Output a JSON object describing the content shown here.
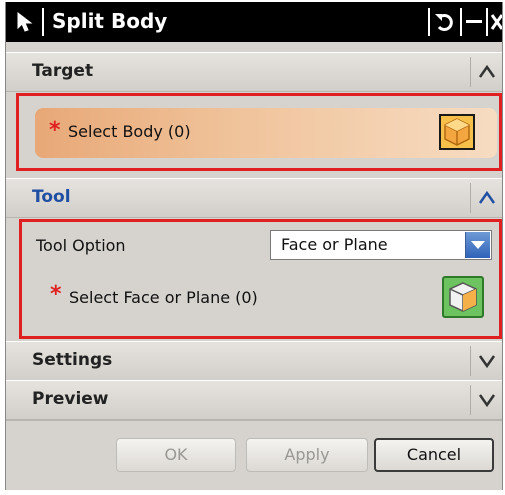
{
  "dialog": {
    "title": "Split Body"
  },
  "groups": {
    "target": {
      "label": "Target",
      "expanded": true
    },
    "tool": {
      "label": "Tool",
      "expanded": true
    },
    "settings": {
      "label": "Settings",
      "expanded": false
    },
    "preview": {
      "label": "Preview",
      "expanded": false
    }
  },
  "target": {
    "required_marker": "*",
    "select_body_label": "Select Body (0)",
    "button_icon": "solid-body-icon"
  },
  "tool": {
    "tool_option_label": "Tool Option",
    "tool_option_value": "Face or Plane",
    "required_marker": "*",
    "select_face_label": "Select Face or Plane (0)",
    "button_icon": "face-select-icon"
  },
  "footer": {
    "ok_label": "OK",
    "apply_label": "Apply",
    "cancel_label": "Cancel"
  },
  "colors": {
    "accent_blue": "#1f4fa3",
    "required_red": "#e02020",
    "highlight_red": "#e02020",
    "target_bar": "#f0c49c"
  }
}
